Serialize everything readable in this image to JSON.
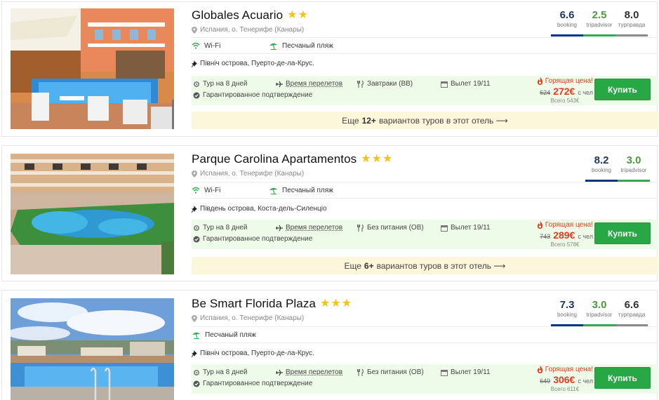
{
  "hotels": [
    {
      "name": "Globales Acuario",
      "stars": 2,
      "location": "Испания, о. Тенерифе (Канары)",
      "amenities": [
        "Wi-Fi",
        "Песчаный пляж"
      ],
      "region": "Північ острова, Пуерто-де-ла-Крус.",
      "tour": "Тур на 8 дней",
      "flight_times": "Время перелетов",
      "meal": "Завтраки (BB)",
      "departure": "Вылет 19/11",
      "guarantee": "Гарантированное подтверждение",
      "hot_label": "Горящая цена!",
      "old_price": "624",
      "new_price": "272€",
      "per": "с чел",
      "total": "Всего 543€",
      "buy": "Купить",
      "more_prefix": "Еще",
      "more_count": "12+",
      "more_suffix": "вариантов туров в этот отель ⟶",
      "ratings": [
        {
          "score": "6.6",
          "label": "booking"
        },
        {
          "score": "2.5",
          "label": "tripadvisor"
        },
        {
          "score": "8.0",
          "label": "турправда"
        }
      ]
    },
    {
      "name": "Parque Carolina Apartamentos",
      "stars": 3,
      "location": "Испания, о. Тенерифе (Канары)",
      "amenities": [
        "Wi-Fi",
        "Песчаный пляж"
      ],
      "region": "Південь острова, Коста-дель-Силенціо",
      "tour": "Тур на 8 дней",
      "flight_times": "Время перелетов",
      "meal": "Без питания (OB)",
      "departure": "Вылет 19/11",
      "guarantee": "Гарантированное подтверждение",
      "hot_label": "Горящая цена!",
      "old_price": "743",
      "new_price": "289€",
      "per": "с чел",
      "total": "Всего 578€",
      "buy": "Купить",
      "more_prefix": "Еще",
      "more_count": "6+",
      "more_suffix": "вариантов туров в этот отель ⟶",
      "ratings": [
        {
          "score": "8.2",
          "label": "booking"
        },
        {
          "score": "3.0",
          "label": "tripadvisor"
        }
      ]
    },
    {
      "name": "Be Smart Florida Plaza",
      "stars": 3,
      "location": "Испания, о. Тенерифе (Канары)",
      "amenities": [
        "Песчаный пляж"
      ],
      "region": "Північ острова, Пуерто-де-ла-Крус.",
      "tour": "Тур на 8 дней",
      "flight_times": "Время перелетов",
      "meal": "Без питания (OB)",
      "departure": "Вылет 19/11",
      "guarantee": "Гарантированное подтверждение",
      "hot_label": "Горящая цена!",
      "old_price": "649",
      "new_price": "306€",
      "per": "с чел",
      "total": "Всего 611€",
      "buy": "Купить",
      "ratings": [
        {
          "score": "7.3",
          "label": "booking"
        },
        {
          "score": "3.0",
          "label": "tripadvisor"
        },
        {
          "score": "6.6",
          "label": "турправда"
        }
      ]
    }
  ],
  "colors": {
    "buy_button": "#28a745",
    "hot_price": "#e63b19",
    "offer_bg": "#eefbe9",
    "more_bg": "#fcf6da",
    "star": "#f0c419",
    "booking": "#003580",
    "tripadvisor": "#34a853"
  }
}
